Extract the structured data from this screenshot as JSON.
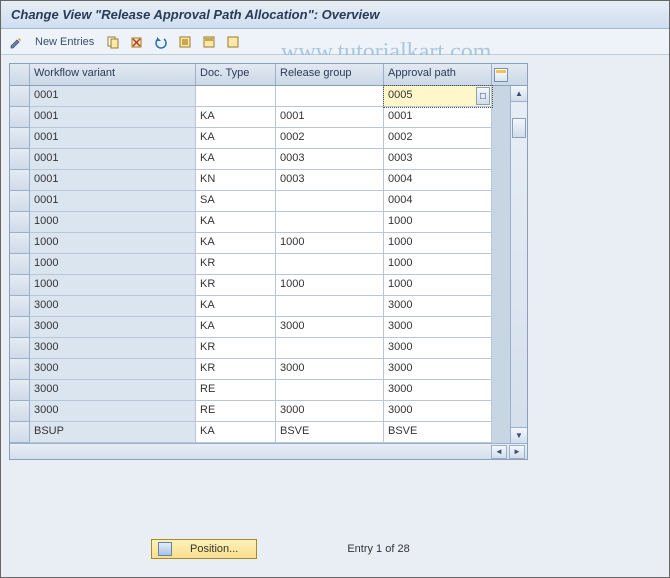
{
  "title": "Change View \"Release Approval Path Allocation\": Overview",
  "toolbar": {
    "new_entries": "New Entries"
  },
  "watermark": "www.tutorialkart.com",
  "columns": {
    "workflow_variant": "Workflow variant",
    "doc_type": "Doc. Type",
    "release_group": "Release group",
    "approval_path": "Approval path"
  },
  "rows": [
    {
      "wv": "0001",
      "dt": "",
      "rg": "",
      "ap": "0005",
      "focus": true
    },
    {
      "wv": "0001",
      "dt": "KA",
      "rg": "0001",
      "ap": "0001"
    },
    {
      "wv": "0001",
      "dt": "KA",
      "rg": "0002",
      "ap": "0002"
    },
    {
      "wv": "0001",
      "dt": "KA",
      "rg": "0003",
      "ap": "0003"
    },
    {
      "wv": "0001",
      "dt": "KN",
      "rg": "0003",
      "ap": "0004"
    },
    {
      "wv": "0001",
      "dt": "SA",
      "rg": "",
      "ap": "0004"
    },
    {
      "wv": "1000",
      "dt": "KA",
      "rg": "",
      "ap": "1000"
    },
    {
      "wv": "1000",
      "dt": "KA",
      "rg": "1000",
      "ap": "1000"
    },
    {
      "wv": "1000",
      "dt": "KR",
      "rg": "",
      "ap": "1000"
    },
    {
      "wv": "1000",
      "dt": "KR",
      "rg": "1000",
      "ap": "1000"
    },
    {
      "wv": "3000",
      "dt": "KA",
      "rg": "",
      "ap": "3000"
    },
    {
      "wv": "3000",
      "dt": "KA",
      "rg": "3000",
      "ap": "3000"
    },
    {
      "wv": "3000",
      "dt": "KR",
      "rg": "",
      "ap": "3000"
    },
    {
      "wv": "3000",
      "dt": "KR",
      "rg": "3000",
      "ap": "3000"
    },
    {
      "wv": "3000",
      "dt": "RE",
      "rg": "",
      "ap": "3000"
    },
    {
      "wv": "3000",
      "dt": "RE",
      "rg": "3000",
      "ap": "3000"
    },
    {
      "wv": "BSUP",
      "dt": "KA",
      "rg": "BSVE",
      "ap": "BSVE"
    }
  ],
  "footer": {
    "position_label": "Position...",
    "entry_text": "Entry 1 of 28"
  }
}
